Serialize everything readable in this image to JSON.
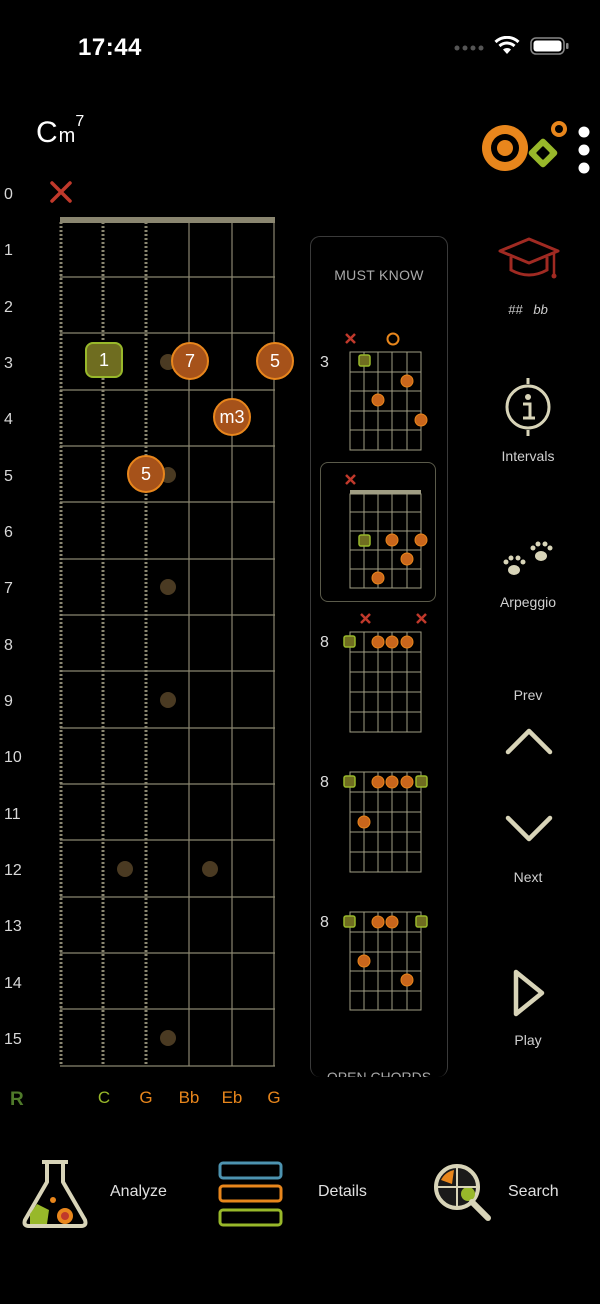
{
  "status": {
    "time": "17:44"
  },
  "chord": {
    "root": "C",
    "quality": "m",
    "extension": "7"
  },
  "fret_numbers": [
    "0",
    "1",
    "2",
    "3",
    "4",
    "5",
    "6",
    "7",
    "8",
    "9",
    "10",
    "11",
    "12",
    "13",
    "14",
    "15"
  ],
  "string_labels": {
    "root_marker": "R",
    "strings": [
      "C",
      "G",
      "Bb",
      "Eb",
      "G"
    ]
  },
  "fretboard": {
    "muted_string_symbol": "×",
    "notes": [
      {
        "label": "1",
        "kind": "root"
      },
      {
        "label": "7",
        "kind": "interval"
      },
      {
        "label": "5",
        "kind": "interval"
      },
      {
        "label": "m3",
        "kind": "interval"
      },
      {
        "label": "5",
        "kind": "interval"
      }
    ]
  },
  "voicings_panel": {
    "header": "MUST KNOW",
    "footer": "OPEN CHORDS",
    "diagrams": [
      {
        "start_fret": "3"
      },
      {
        "start_fret": ""
      },
      {
        "start_fret": "8"
      },
      {
        "start_fret": "8"
      },
      {
        "start_fret": "8"
      }
    ]
  },
  "right_controls": {
    "accidentals": "##   bb",
    "intervals": "Intervals",
    "arpeggio": "Arpeggio",
    "prev": "Prev",
    "next": "Next",
    "play": "Play"
  },
  "bottom_bar": {
    "analyze": "Analyze",
    "details": "Details",
    "search": "Search"
  },
  "colors": {
    "orange": "#e8861c",
    "green": "#98b82a",
    "fret_line": "#8a8670",
    "accent_red": "#c0392b"
  }
}
